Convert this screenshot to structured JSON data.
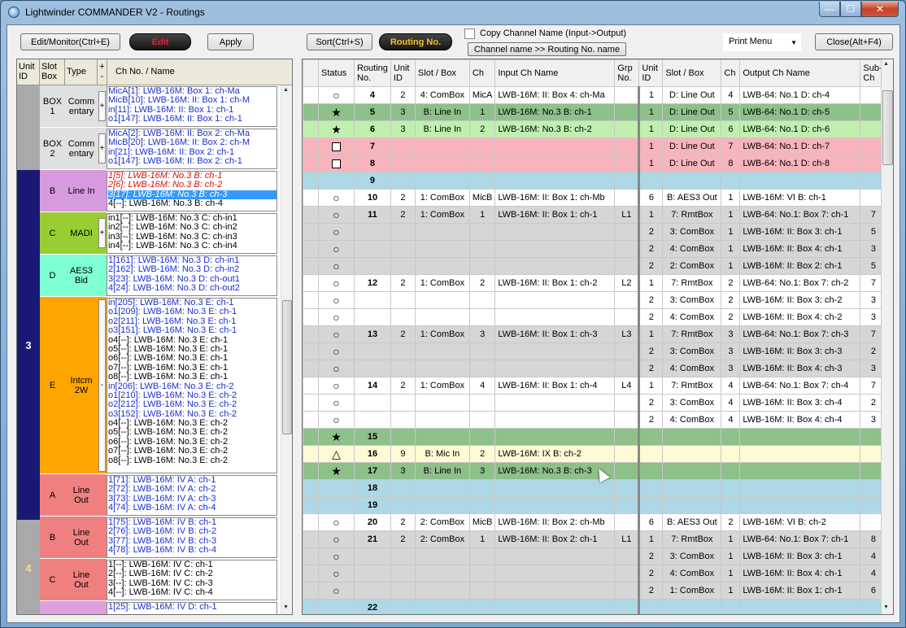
{
  "window": {
    "title": "Lightwinder COMMANDER V2 - Routings",
    "min": "—",
    "max": "☐",
    "close": "✕"
  },
  "toolbar": {
    "edit_monitor": "Edit/Monitor(Ctrl+E)",
    "edit": "Edit",
    "apply": "Apply",
    "sort": "Sort(Ctrl+S)",
    "routing_no": "Routing No.",
    "copy_channel_label": "Copy Channel Name (Input->Output)",
    "channel_name_btn": "Channel name >> Routing No. name",
    "print_menu": "Print Menu",
    "close": "Close(Alt+F4)"
  },
  "left_panel": {
    "headers": {
      "unit": "Unit ID",
      "slot": "Slot Box",
      "type": "Type",
      "pm": "+ -",
      "chname": "Ch No. / Name"
    },
    "units": [
      {
        "id": "",
        "color": "#a9a9a9"
      },
      {
        "id": "3",
        "color": "#191975"
      },
      {
        "id": "4",
        "color": "#a9a9a9"
      }
    ],
    "slots": [
      {
        "slot": "BOX\n1",
        "type": "Comm\nentary",
        "color": "#e0e0e0",
        "pm": "+",
        "channels": [
          [
            "blue",
            "MicA[1]: LWB-16M: Box 1: ch-Ma"
          ],
          [
            "blue",
            "MicB[10]: LWB-16M: II: Box 1: ch-M"
          ],
          [
            "blue",
            "in[11]: LWB-16M: II: Box 1: ch-1"
          ],
          [
            "blue",
            "o1[147]: LWB-16M: II: Box 1: ch-1"
          ]
        ]
      },
      {
        "slot": "BOX\n2",
        "type": "Comm\nentary",
        "color": "#e0e0e0",
        "pm": "+",
        "channels": [
          [
            "blue",
            "MicA[2]: LWB-16M: II: Box 2: ch-Ma"
          ],
          [
            "blue",
            "MicB[20]: LWB-16M: II: Box 2: ch-M"
          ],
          [
            "blue",
            "in[21]: LWB-16M: II: Box 2: ch-1"
          ],
          [
            "blue",
            "o1[147]: LWB-16M: II: Box 2: ch-1"
          ]
        ]
      },
      {
        "slot": "B",
        "type": "Line In",
        "color": "#d89adf",
        "pm": "",
        "channels": [
          [
            "red",
            "1[5]: LWB-16M: No.3 B: ch-1"
          ],
          [
            "red",
            "2[6]: LWB-16M: No.3 B: ch-2"
          ],
          [
            "sel",
            "3[17]: LWB-16M: No.3 B: ch-3"
          ],
          [
            "blk",
            "4[--]: LWB-16M: No.3 B: ch-4"
          ]
        ]
      },
      {
        "slot": "C",
        "type": "MADI",
        "color": "#9acd32",
        "pm": "+",
        "channels": [
          [
            "blk",
            "in1[--]: LWB-16M: No.3 C: ch-in1"
          ],
          [
            "blk",
            "in2[--]: LWB-16M: No.3 C: ch-in2"
          ],
          [
            "blk",
            "in3[--]: LWB-16M: No.3 C: ch-in3"
          ],
          [
            "blk",
            "in4[--]: LWB-16M: No.3 C: ch-in4"
          ]
        ]
      },
      {
        "slot": "D",
        "type": "AES3\nBid",
        "color": "#7fffd4",
        "pm": "",
        "channels": [
          [
            "blue",
            "1[161]: LWB-16M: No.3 D: ch-in1"
          ],
          [
            "blue",
            "2[162]: LWB-16M: No.3 D: ch-in2"
          ],
          [
            "blue",
            "3[23]: LWB-16M: No.3 D: ch-out1"
          ],
          [
            "blue",
            "4[24]: LWB-16M: No.3 D: ch-out2"
          ]
        ]
      },
      {
        "slot": "E",
        "type": "Intcm\n2W",
        "color": "#ffa500",
        "pm": "-",
        "channels": [
          [
            "blue",
            "in[205]: LWB-16M: No.3 E: ch-1"
          ],
          [
            "blue",
            "o1[209]: LWB-16M: No.3 E: ch-1"
          ],
          [
            "blue",
            "o2[211]: LWB-16M: No.3 E: ch-1"
          ],
          [
            "blue",
            "o3[151]: LWB-16M: No.3 E: ch-1"
          ],
          [
            "blk",
            "o4[--]: LWB-16M: No.3 E: ch-1"
          ],
          [
            "blk",
            "o5[--]: LWB-16M: No.3 E: ch-1"
          ],
          [
            "blk",
            "o6[--]: LWB-16M: No.3 E: ch-1"
          ],
          [
            "blk",
            "o7[--]: LWB-16M: No.3 E: ch-1"
          ],
          [
            "blk",
            "o8[--]: LWB-16M: No.3 E: ch-1"
          ],
          [
            "blue",
            "in[206]: LWB-16M: No.3 E: ch-2"
          ],
          [
            "blue",
            "o1[210]: LWB-16M: No.3 E: ch-2"
          ],
          [
            "blue",
            "o2[212]: LWB-16M: No.3 E: ch-2"
          ],
          [
            "blue",
            "o3[152]: LWB-16M: No.3 E: ch-2"
          ],
          [
            "blk",
            "o4[--]: LWB-16M: No.3 E: ch-2"
          ],
          [
            "blk",
            "o5[--]: LWB-16M: No.3 E: ch-2"
          ],
          [
            "blk",
            "o6[--]: LWB-16M: No.3 E: ch-2"
          ],
          [
            "blk",
            "o7[--]: LWB-16M: No.3 E: ch-2"
          ],
          [
            "blk",
            "o8[--]: LWB-16M: No.3 E: ch-2"
          ]
        ]
      },
      {
        "slot": "A",
        "type": "Line\nOut",
        "color": "#f08080",
        "pm": "",
        "channels": [
          [
            "blue",
            "1[71]: LWB-16M: IV A: ch-1"
          ],
          [
            "blue",
            "2[72]: LWB-16M: IV A: ch-2"
          ],
          [
            "blue",
            "3[73]: LWB-16M: IV A: ch-3"
          ],
          [
            "blue",
            "4[74]: LWB-16M: IV A: ch-4"
          ]
        ]
      },
      {
        "slot": "B",
        "type": "Line\nOut",
        "color": "#f08080",
        "pm": "",
        "channels": [
          [
            "blue",
            "1[75]: LWB-16M: IV B: ch-1"
          ],
          [
            "blue",
            "2[76]: LWB-16M: IV B: ch-2"
          ],
          [
            "blue",
            "3[77]: LWB-16M: IV B: ch-3"
          ],
          [
            "blue",
            "4[78]: LWB-16M: IV B: ch-4"
          ]
        ]
      },
      {
        "slot": "C",
        "type": "Line\nOut",
        "color": "#f08080",
        "pm": "",
        "channels": [
          [
            "blk",
            "1[--]: LWB-16M: IV C: ch-1"
          ],
          [
            "blk",
            "2[--]: LWB-16M: IV C: ch-2"
          ],
          [
            "blk",
            "3[--]: LWB-16M: IV C: ch-3"
          ],
          [
            "blk",
            "4[--]: LWB-16M: IV C: ch-4"
          ]
        ]
      },
      {
        "slot": "",
        "type": "",
        "color": "#dda0dd",
        "pm": "",
        "channels": [
          [
            "blue",
            "1[25]: LWB-16M: IV D: ch-1"
          ]
        ]
      }
    ]
  },
  "grid": {
    "headers": [
      "",
      "Status",
      "Routing\nNo.",
      "Unit\nID",
      "Slot / Box",
      "Ch",
      "Input Ch Name",
      "Grp\nNo.",
      "Unit\nID",
      "Slot / Box",
      "Ch",
      "Output Ch Name",
      "Sub-\nCh"
    ],
    "rows": [
      {
        "cls": "white",
        "st": "circle",
        "no": "4",
        "u": "2",
        "sb": "4: ComBox",
        "ch": "MicA",
        "in": "LWB-16M: II: Box 4: ch-Ma",
        "g": "",
        "ou": "1",
        "osb": "D: Line Out",
        "och": "4",
        "out": "LWB-64: No.1 D: ch-4",
        "sub": ""
      },
      {
        "cls": "green",
        "st": "star",
        "no": "5",
        "u": "3",
        "sb": "B: Line In",
        "ch": "1",
        "in": "LWB-16M: No.3 B: ch-1",
        "g": "",
        "ou": "1",
        "osb": "D: Line Out",
        "och": "5",
        "out": "LWB-64: No.1 D: ch-5",
        "sub": ""
      },
      {
        "cls": "lgreen",
        "st": "star",
        "no": "6",
        "u": "3",
        "sb": "B: Line In",
        "ch": "2",
        "in": "LWB-16M: No.3 B: ch-2",
        "g": "",
        "ou": "1",
        "osb": "D: Line Out",
        "och": "6",
        "out": "LWB-64: No.1 D: ch-6",
        "sub": ""
      },
      {
        "cls": "pink",
        "st": "square",
        "no": "7",
        "u": "",
        "sb": "",
        "ch": "",
        "in": "",
        "g": "",
        "ou": "1",
        "osb": "D: Line Out",
        "och": "7",
        "out": "LWB-64: No.1 D: ch-7",
        "sub": ""
      },
      {
        "cls": "pink",
        "st": "square",
        "no": "8",
        "u": "",
        "sb": "",
        "ch": "",
        "in": "",
        "g": "",
        "ou": "1",
        "osb": "D: Line Out",
        "och": "8",
        "out": "LWB-64: No.1 D: ch-8",
        "sub": ""
      },
      {
        "cls": "lblue",
        "st": "",
        "no": "9",
        "u": "",
        "sb": "",
        "ch": "",
        "in": "",
        "g": "",
        "ou": "",
        "osb": "",
        "och": "",
        "out": "",
        "sub": ""
      },
      {
        "cls": "white",
        "st": "circle",
        "no": "10",
        "u": "2",
        "sb": "1: ComBox",
        "ch": "MicB",
        "in": "LWB-16M: II: Box 1: ch-Mb",
        "g": "",
        "ou": "6",
        "osb": "B: AES3 Out",
        "och": "1",
        "out": "LWB-16M: VI B: ch-1",
        "sub": ""
      },
      {
        "cls": "gray",
        "st": "circle",
        "no": "11",
        "u": "2",
        "sb": "1: ComBox",
        "ch": "1",
        "in": "LWB-16M: II: Box 1: ch-1",
        "g": "L1",
        "ou": "1",
        "osb": "7: RmtBox",
        "och": "1",
        "out": "LWB-64: No.1: Box 7: ch-1",
        "sub": "7"
      },
      {
        "cls": "gray",
        "st": "circle",
        "no": "",
        "u": "",
        "sb": "",
        "ch": "",
        "in": "",
        "g": "",
        "ou": "2",
        "osb": "3: ComBox",
        "och": "1",
        "out": "LWB-16M: II: Box 3: ch-1",
        "sub": "5"
      },
      {
        "cls": "gray",
        "st": "circle",
        "no": "",
        "u": "",
        "sb": "",
        "ch": "",
        "in": "",
        "g": "",
        "ou": "2",
        "osb": "4: ComBox",
        "och": "1",
        "out": "LWB-16M: II: Box 4: ch-1",
        "sub": "3"
      },
      {
        "cls": "gray",
        "st": "circle",
        "no": "",
        "u": "",
        "sb": "",
        "ch": "",
        "in": "",
        "g": "",
        "ou": "2",
        "osb": "2: ComBox",
        "och": "1",
        "out": "LWB-16M: II: Box 2: ch-1",
        "sub": "5"
      },
      {
        "cls": "white",
        "st": "circle",
        "no": "12",
        "u": "2",
        "sb": "1: ComBox",
        "ch": "2",
        "in": "LWB-16M: II: Box 1: ch-2",
        "g": "L2",
        "ou": "1",
        "osb": "7: RmtBox",
        "och": "2",
        "out": "LWB-64: No.1: Box 7: ch-2",
        "sub": "7"
      },
      {
        "cls": "white",
        "st": "circle",
        "no": "",
        "u": "",
        "sb": "",
        "ch": "",
        "in": "",
        "g": "",
        "ou": "2",
        "osb": "3: ComBox",
        "och": "2",
        "out": "LWB-16M: II: Box 3: ch-2",
        "sub": "3"
      },
      {
        "cls": "white",
        "st": "circle",
        "no": "",
        "u": "",
        "sb": "",
        "ch": "",
        "in": "",
        "g": "",
        "ou": "2",
        "osb": "4: ComBox",
        "och": "2",
        "out": "LWB-16M: II: Box 4: ch-2",
        "sub": "3"
      },
      {
        "cls": "gray",
        "st": "circle",
        "no": "13",
        "u": "2",
        "sb": "1: ComBox",
        "ch": "3",
        "in": "LWB-16M: II: Box 1: ch-3",
        "g": "L3",
        "ou": "1",
        "osb": "7: RmtBox",
        "och": "3",
        "out": "LWB-64: No.1: Box 7: ch-3",
        "sub": "7"
      },
      {
        "cls": "gray",
        "st": "circle",
        "no": "",
        "u": "",
        "sb": "",
        "ch": "",
        "in": "",
        "g": "",
        "ou": "2",
        "osb": "3: ComBox",
        "och": "3",
        "out": "LWB-16M: II: Box 3: ch-3",
        "sub": "2"
      },
      {
        "cls": "gray",
        "st": "circle",
        "no": "",
        "u": "",
        "sb": "",
        "ch": "",
        "in": "",
        "g": "",
        "ou": "2",
        "osb": "4: ComBox",
        "och": "3",
        "out": "LWB-16M: II: Box 4: ch-3",
        "sub": "3"
      },
      {
        "cls": "white",
        "st": "circle",
        "no": "14",
        "u": "2",
        "sb": "1: ComBox",
        "ch": "4",
        "in": "LWB-16M: II: Box 1: ch-4",
        "g": "L4",
        "ou": "1",
        "osb": "7: RmtBox",
        "och": "4",
        "out": "LWB-64: No.1: Box 7: ch-4",
        "sub": "7"
      },
      {
        "cls": "white",
        "st": "circle",
        "no": "",
        "u": "",
        "sb": "",
        "ch": "",
        "in": "",
        "g": "",
        "ou": "2",
        "osb": "3: ComBox",
        "och": "4",
        "out": "LWB-16M: II: Box 3: ch-4",
        "sub": "2"
      },
      {
        "cls": "white",
        "st": "circle",
        "no": "",
        "u": "",
        "sb": "",
        "ch": "",
        "in": "",
        "g": "",
        "ou": "2",
        "osb": "4: ComBox",
        "och": "4",
        "out": "LWB-16M: II: Box 4: ch-4",
        "sub": "3"
      },
      {
        "cls": "green",
        "st": "star",
        "no": "15",
        "u": "",
        "sb": "",
        "ch": "",
        "in": "",
        "g": "",
        "ou": "",
        "osb": "",
        "och": "",
        "out": "",
        "sub": ""
      },
      {
        "cls": "yellow",
        "st": "triangle",
        "no": "16",
        "u": "9",
        "sb": "B: Mic In",
        "ch": "2",
        "in": "LWB-16M: IX B: ch-2",
        "g": "",
        "ou": "",
        "osb": "",
        "och": "",
        "out": "",
        "sub": ""
      },
      {
        "cls": "green",
        "st": "star",
        "no": "17",
        "u": "3",
        "sb": "B: Line In",
        "ch": "3",
        "in": "LWB-16M: No.3 B: ch-3",
        "g": "",
        "ou": "",
        "osb": "",
        "och": "",
        "out": "",
        "sub": ""
      },
      {
        "cls": "lblue",
        "st": "",
        "no": "18",
        "u": "",
        "sb": "",
        "ch": "",
        "in": "",
        "g": "",
        "ou": "",
        "osb": "",
        "och": "",
        "out": "",
        "sub": ""
      },
      {
        "cls": "lblue",
        "st": "",
        "no": "19",
        "u": "",
        "sb": "",
        "ch": "",
        "in": "",
        "g": "",
        "ou": "",
        "osb": "",
        "och": "",
        "out": "",
        "sub": ""
      },
      {
        "cls": "white",
        "st": "circle",
        "no": "20",
        "u": "2",
        "sb": "2: ComBox",
        "ch": "MicB",
        "in": "LWB-16M: II: Box 2: ch-Mb",
        "g": "",
        "ou": "6",
        "osb": "B: AES3 Out",
        "och": "2",
        "out": "LWB-16M: VI B: ch-2",
        "sub": ""
      },
      {
        "cls": "gray",
        "st": "circle",
        "no": "21",
        "u": "2",
        "sb": "2: ComBox",
        "ch": "1",
        "in": "LWB-16M: II: Box 2: ch-1",
        "g": "L1",
        "ou": "1",
        "osb": "7: RmtBox",
        "och": "1",
        "out": "LWB-64: No.1: Box 7: ch-1",
        "sub": "8"
      },
      {
        "cls": "gray",
        "st": "circle",
        "no": "",
        "u": "",
        "sb": "",
        "ch": "",
        "in": "",
        "g": "",
        "ou": "2",
        "osb": "3: ComBox",
        "och": "1",
        "out": "LWB-16M: II: Box 3: ch-1",
        "sub": "4"
      },
      {
        "cls": "gray",
        "st": "circle",
        "no": "",
        "u": "",
        "sb": "",
        "ch": "",
        "in": "",
        "g": "",
        "ou": "2",
        "osb": "4: ComBox",
        "och": "1",
        "out": "LWB-16M: II: Box 4: ch-1",
        "sub": "4"
      },
      {
        "cls": "gray",
        "st": "circle",
        "no": "",
        "u": "",
        "sb": "",
        "ch": "",
        "in": "",
        "g": "",
        "ou": "2",
        "osb": "1: ComBox",
        "och": "1",
        "out": "LWB-16M: II: Box 1: ch-1",
        "sub": "6"
      },
      {
        "cls": "lblue",
        "st": "",
        "no": "22",
        "u": "",
        "sb": "",
        "ch": "",
        "in": "",
        "g": "",
        "ou": "",
        "osb": "",
        "och": "",
        "out": "",
        "sub": ""
      }
    ]
  }
}
